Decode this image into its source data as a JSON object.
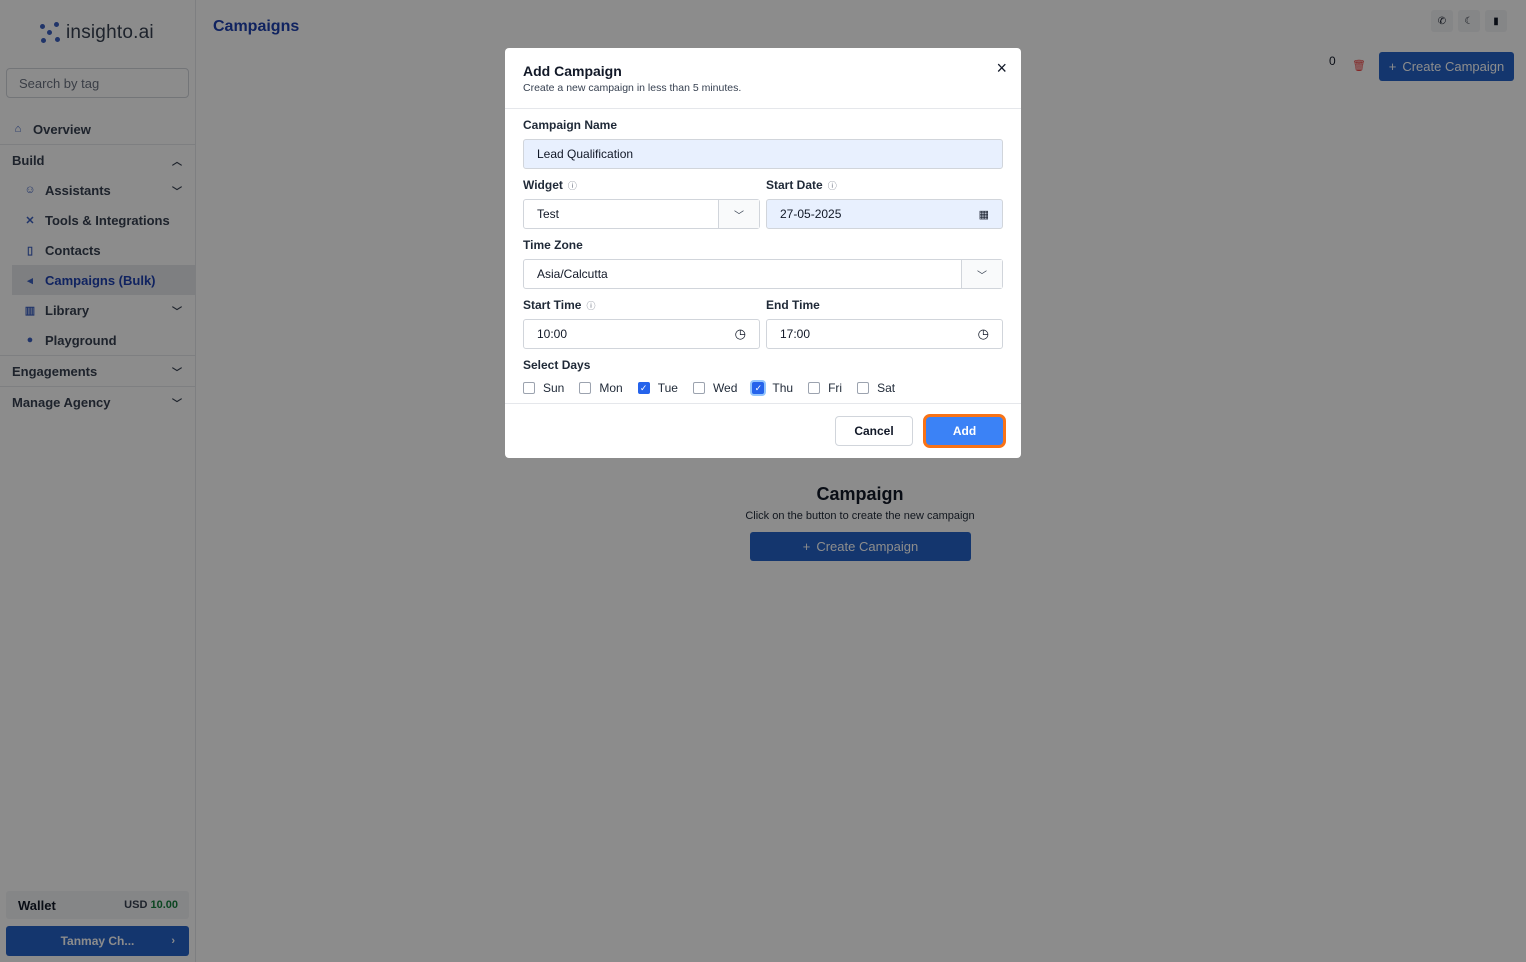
{
  "brand": {
    "name": "insighto.ai"
  },
  "search": {
    "placeholder": "Search by tag"
  },
  "sidebar": {
    "items": [
      {
        "label": "Overview",
        "icon": "home-icon"
      },
      {
        "label": "Build",
        "icon": "chevron-up-icon"
      },
      {
        "label": "Assistants",
        "icon": "user-icon"
      },
      {
        "label": "Tools & Integrations",
        "icon": "tools-icon"
      },
      {
        "label": "Contacts",
        "icon": "document-icon"
      },
      {
        "label": "Campaigns (Bulk)",
        "icon": "megaphone-icon"
      },
      {
        "label": "Library",
        "icon": "library-icon"
      },
      {
        "label": "Playground",
        "icon": "gamepad-icon"
      },
      {
        "label": "Engagements",
        "icon": "chevron-down-icon"
      },
      {
        "label": "Manage Agency",
        "icon": "chevron-down-icon"
      }
    ],
    "wallet": {
      "label": "Wallet",
      "currency": "USD",
      "amount": "10.00"
    },
    "user": {
      "name": "Tanmay Ch..."
    }
  },
  "header": {
    "title": "Campaigns",
    "count": "0",
    "create_label": "Create Campaign"
  },
  "empty_state": {
    "title": "Campaign",
    "subtitle": "Click on the button to create the new campaign",
    "create_label": "Create Campaign"
  },
  "modal": {
    "title": "Add Campaign",
    "subtitle": "Create a new campaign in less than 5 minutes.",
    "campaign_name": {
      "label": "Campaign Name",
      "value": "Lead Qualification"
    },
    "widget": {
      "label": "Widget",
      "value": "Test"
    },
    "start_date": {
      "label": "Start Date",
      "value": "27-05-2025"
    },
    "time_zone": {
      "label": "Time Zone",
      "value": "Asia/Calcutta"
    },
    "start_time": {
      "label": "Start Time",
      "value": "10:00"
    },
    "end_time": {
      "label": "End Time",
      "value": "17:00"
    },
    "select_days": {
      "label": "Select Days",
      "days": [
        {
          "label": "Sun",
          "checked": false
        },
        {
          "label": "Mon",
          "checked": false
        },
        {
          "label": "Tue",
          "checked": true
        },
        {
          "label": "Wed",
          "checked": false
        },
        {
          "label": "Thu",
          "checked": true
        },
        {
          "label": "Fri",
          "checked": false
        },
        {
          "label": "Sat",
          "checked": false
        }
      ]
    },
    "cancel_label": "Cancel",
    "add_label": "Add"
  },
  "colors": {
    "accent": "#2563c9",
    "add_button": "#3b82f6",
    "focus_ring": "#f97316",
    "wallet_amount": "#15803d"
  }
}
